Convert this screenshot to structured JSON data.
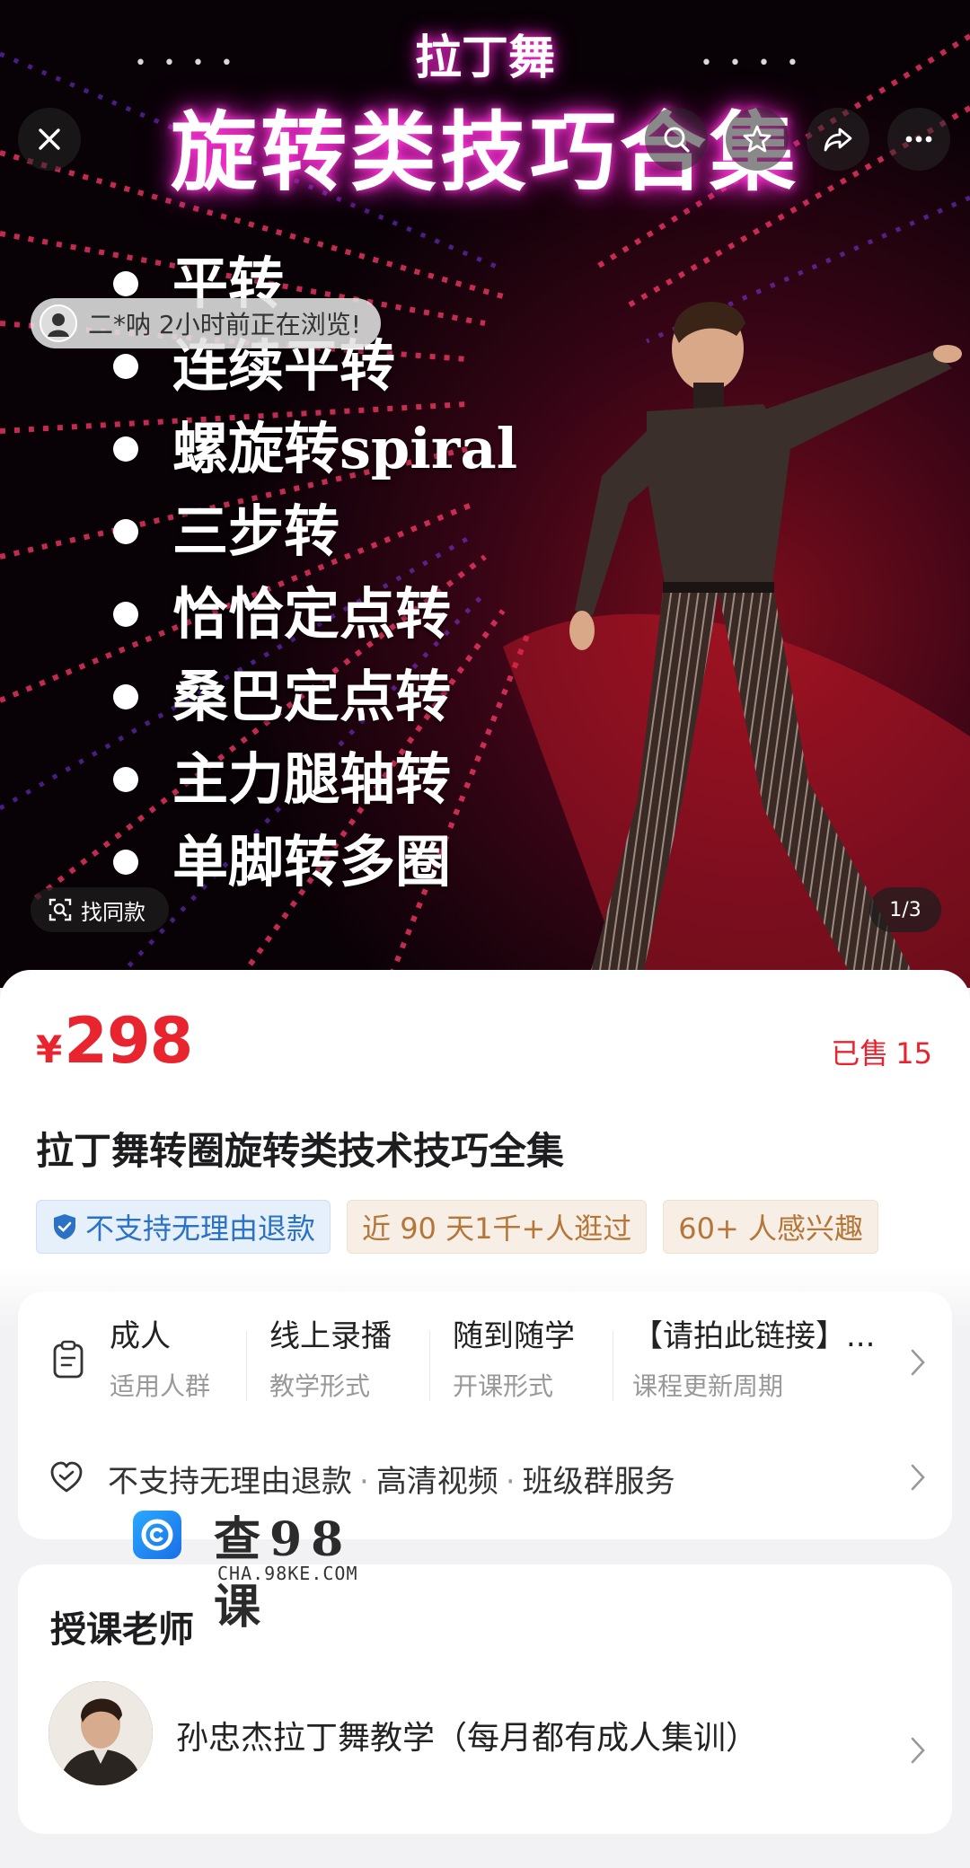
{
  "hero": {
    "poster_top_title": "拉丁舞",
    "poster_title": "旋转类技巧合集",
    "poster_items": [
      "平转",
      "连续平转",
      "螺旋转spiral",
      "三步转",
      "恰恰定点转",
      "桑巴定点转",
      "主力腿轴转",
      "单脚转多圈"
    ],
    "browse_toast": "二*呐 2小时前正在浏览!",
    "find_same_label": "找同款",
    "page_indicator": "1/3"
  },
  "product": {
    "currency": "¥",
    "price": "298",
    "sold_label": "已售",
    "sold_count": "15",
    "title": "拉丁舞转圈旋转类技术技巧全集",
    "tags": [
      "不支持无理由退款",
      "近 90 天1千+人逛过",
      "60+ 人感兴趣"
    ]
  },
  "attributes": [
    {
      "value": "成人",
      "key": "适用人群"
    },
    {
      "value": "线上录播",
      "key": "教学形式"
    },
    {
      "value": "随到随学",
      "key": "开课形式"
    },
    {
      "value": "【请拍此链接】...",
      "key": "课程更新周期"
    }
  ],
  "services": [
    "不支持无理由退款",
    "高清视频",
    "班级群服务"
  ],
  "service_sep": "·",
  "teacher": {
    "section_title": "授课老师",
    "name": "孙忠杰拉丁舞教学（每月都有成人集训）"
  },
  "watermark": {
    "brand": "查98课",
    "sub": "CHA.98KE.COM"
  },
  "colors": {
    "price_red": "#e8242f",
    "tag_blue": "#2b72c7",
    "tag_beige": "#b5763a",
    "neon_pink": "#ff2bd6"
  },
  "icons": {
    "close": "close-icon",
    "search": "search-icon",
    "favorite": "star-icon",
    "share": "share-icon",
    "more": "more-icon"
  }
}
